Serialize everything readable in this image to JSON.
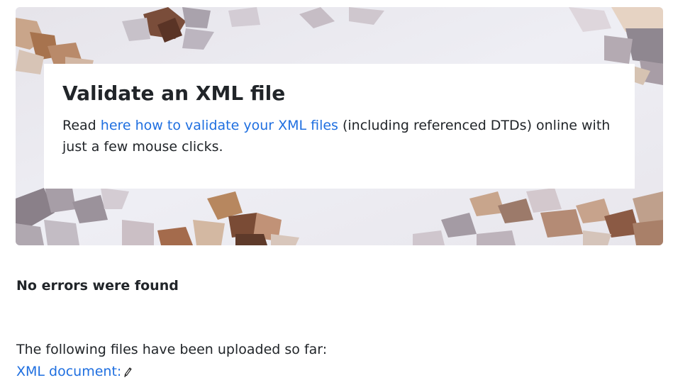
{
  "hero": {
    "title": "Validate an XML file",
    "text_before": "Read ",
    "link_text": "here how to validate your XML files",
    "text_after": " (including referenced DTDs) online with just a few mouse clicks."
  },
  "status": {
    "message": "No errors were found"
  },
  "uploads": {
    "label": "The following files have been uploaded so far:",
    "files": [
      {
        "name": "XML document:",
        "icon": "pencil-icon"
      }
    ]
  },
  "colors": {
    "link": "#1f6fe0",
    "text": "#212529",
    "hero_bg": "#e9eaf0"
  }
}
